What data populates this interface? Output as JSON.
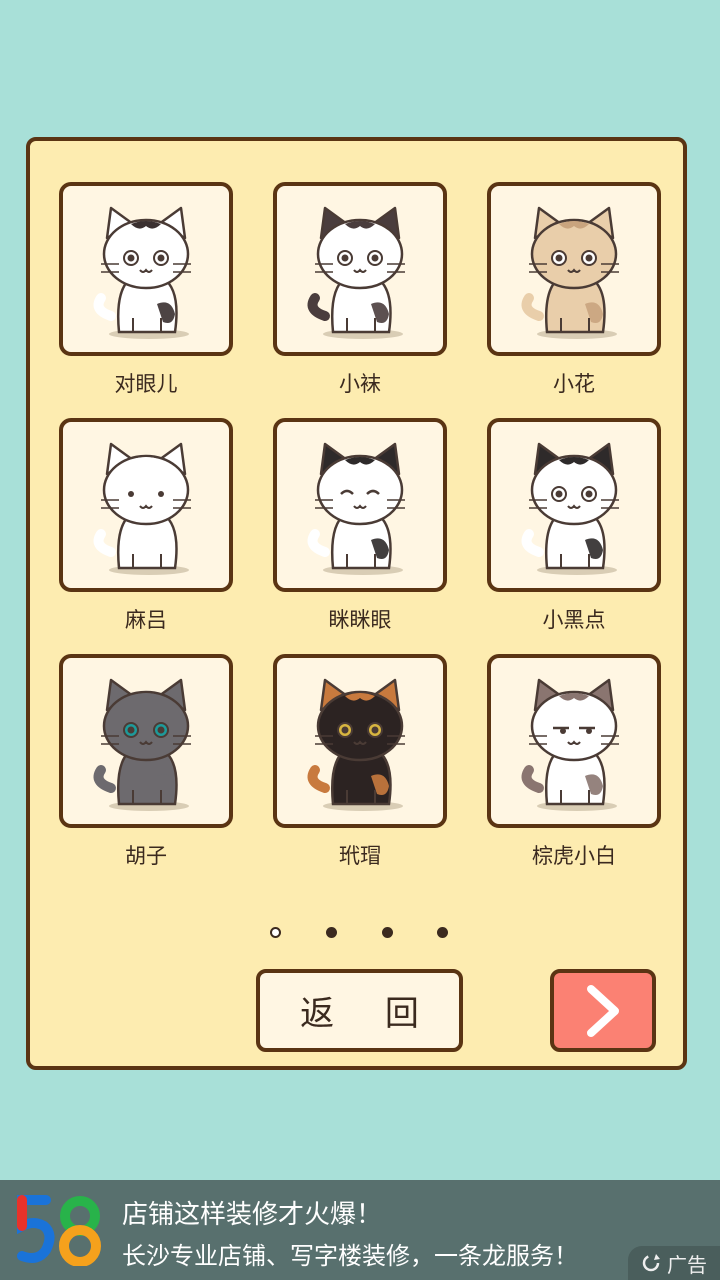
{
  "cats": [
    {
      "name": "对眼儿",
      "body": "#ffffff",
      "ears": "#ffffff",
      "patch": "#3a3030",
      "tail": "#ffffff",
      "eye": "dot"
    },
    {
      "name": "小袜",
      "body": "#ffffff",
      "ears": "#4a3d3d",
      "patch": "#4a3d3d",
      "tail": "#4a3d3d",
      "eye": "ring"
    },
    {
      "name": "小花",
      "body": "#e9ceaa",
      "ears": "#e9ceaa",
      "patch": "#c9a47e",
      "tail": "#e9ceaa",
      "eye": "ring"
    },
    {
      "name": "麻吕",
      "body": "#ffffff",
      "ears": "#ffffff",
      "patch": "#ffffff",
      "tail": "#ffffff",
      "eye": "small"
    },
    {
      "name": "眯眯眼",
      "body": "#ffffff",
      "ears": "#2e2a2a",
      "patch": "#2e2a2a",
      "tail": "#ffffff",
      "eye": "closed"
    },
    {
      "name": "小黑点",
      "body": "#ffffff",
      "ears": "#2e2a2a",
      "patch": "#2e2a2a",
      "tail": "#ffffff",
      "eye": "ring"
    },
    {
      "name": "胡子",
      "body": "#6d6a6e",
      "ears": "#6d6a6e",
      "patch": "#6d6a6e",
      "tail": "#6d6a6e",
      "eye": "teal"
    },
    {
      "name": "玳瑁",
      "body": "#2c2322",
      "ears": "#c87a3e",
      "patch": "#c87a3e",
      "tail": "#c87a3e",
      "eye": "gold"
    },
    {
      "name": "棕虎小白",
      "body": "#ffffff",
      "ears": "#8a7570",
      "patch": "#8a7570",
      "tail": "#8a7570",
      "eye": "sleepy"
    }
  ],
  "pager": {
    "total": 4,
    "current": 0
  },
  "buttons": {
    "back_label": "返 回",
    "next_icon": "chevron-right-icon"
  },
  "ad": {
    "logo_text": "58",
    "title": "店铺这样装修才火爆！",
    "text": "长沙专业店铺、写字楼装修，一条龙服务！",
    "badge_label": "广告"
  },
  "colors": {
    "background": "#a8e0d8",
    "panel": "#fdecb0",
    "border": "#5a3413",
    "next_button": "#fb8173",
    "ad_bar": "#58706e"
  }
}
